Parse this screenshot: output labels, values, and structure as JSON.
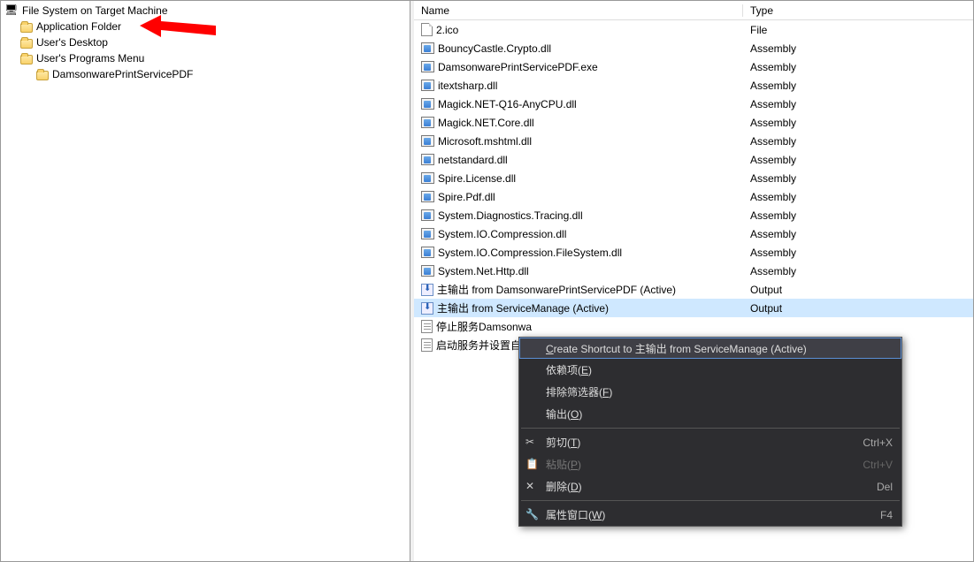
{
  "tree": {
    "root": "File System on Target Machine",
    "items": [
      "Application Folder",
      "User's Desktop",
      "User's Programs Menu"
    ],
    "sub": "DamsonwarePrintServicePDF"
  },
  "headers": {
    "name": "Name",
    "type": "Type"
  },
  "rows": [
    {
      "name": "2.ico",
      "type": "File",
      "icon": "file"
    },
    {
      "name": "BouncyCastle.Crypto.dll",
      "type": "Assembly",
      "icon": "dll"
    },
    {
      "name": "DamsonwarePrintServicePDF.exe",
      "type": "Assembly",
      "icon": "dll"
    },
    {
      "name": "itextsharp.dll",
      "type": "Assembly",
      "icon": "dll"
    },
    {
      "name": "Magick.NET-Q16-AnyCPU.dll",
      "type": "Assembly",
      "icon": "dll"
    },
    {
      "name": "Magick.NET.Core.dll",
      "type": "Assembly",
      "icon": "dll"
    },
    {
      "name": "Microsoft.mshtml.dll",
      "type": "Assembly",
      "icon": "dll"
    },
    {
      "name": "netstandard.dll",
      "type": "Assembly",
      "icon": "dll"
    },
    {
      "name": "Spire.License.dll",
      "type": "Assembly",
      "icon": "dll"
    },
    {
      "name": "Spire.Pdf.dll",
      "type": "Assembly",
      "icon": "dll"
    },
    {
      "name": "System.Diagnostics.Tracing.dll",
      "type": "Assembly",
      "icon": "dll"
    },
    {
      "name": "System.IO.Compression.dll",
      "type": "Assembly",
      "icon": "dll"
    },
    {
      "name": "System.IO.Compression.FileSystem.dll",
      "type": "Assembly",
      "icon": "dll"
    },
    {
      "name": "System.Net.Http.dll",
      "type": "Assembly",
      "icon": "dll"
    },
    {
      "name": "主输出 from DamsonwarePrintServicePDF (Active)",
      "type": "Output",
      "icon": "output"
    },
    {
      "name": "主输出 from ServiceManage (Active)",
      "type": "Output",
      "icon": "output",
      "selected": true
    },
    {
      "name": "停止服务Damsonwa",
      "type": "",
      "icon": "doc"
    },
    {
      "name": "启动服务并设置自动",
      "type": "",
      "icon": "doc"
    }
  ],
  "ctx": {
    "create": "Create Shortcut to 主输出 from ServiceManage (Active)",
    "deps": "依赖项(E)",
    "filter": "排除筛选器(F)",
    "output": "输出(O)",
    "cut": "剪切(T)",
    "cut_key": "Ctrl+X",
    "paste": "粘贴(P)",
    "paste_key": "Ctrl+V",
    "delete": "删除(D)",
    "delete_key": "Del",
    "props": "属性窗口(W)",
    "props_key": "F4"
  }
}
